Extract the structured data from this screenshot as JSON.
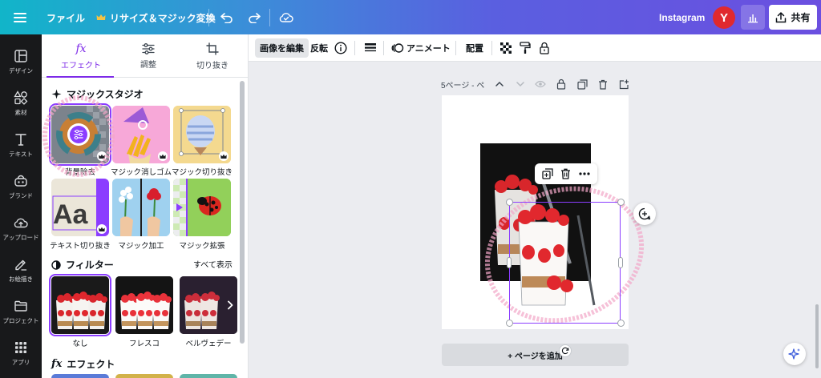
{
  "topbar": {
    "file_label": "ファイル",
    "resize_label": "リサイズ＆マジック変換",
    "design_type": "Instagram",
    "avatar_initial": "Y",
    "share_label": "共有"
  },
  "rail": {
    "items": [
      {
        "label": "デザイン",
        "icon": "layout-icon"
      },
      {
        "label": "素材",
        "icon": "shapes-icon"
      },
      {
        "label": "テキスト",
        "icon": "text-icon"
      },
      {
        "label": "ブランド",
        "icon": "brand-icon"
      },
      {
        "label": "アップロード",
        "icon": "upload-cloud-icon"
      },
      {
        "label": "お絵描き",
        "icon": "draw-icon"
      },
      {
        "label": "プロジェクト",
        "icon": "folder-icon"
      },
      {
        "label": "アプリ",
        "icon": "apps-grid-icon"
      }
    ]
  },
  "panel": {
    "tabs": [
      {
        "label": "エフェクト",
        "icon": "fx-icon",
        "active": true
      },
      {
        "label": "調整",
        "icon": "sliders-icon",
        "active": false
      },
      {
        "label": "切り抜き",
        "icon": "crop-icon",
        "active": false
      }
    ],
    "magic_studio": {
      "title": "マジックスタジオ",
      "tools": [
        {
          "label": "背景除去"
        },
        {
          "label": "マジック消しゴム"
        },
        {
          "label": "マジック切り抜き"
        },
        {
          "label": "テキスト切り抜き"
        },
        {
          "label": "マジック加工"
        },
        {
          "label": "マジック拡張"
        }
      ]
    },
    "filters": {
      "title": "フィルター",
      "see_all": "すべて表示",
      "items": [
        {
          "label": "なし",
          "selected": true
        },
        {
          "label": "フレスコ",
          "selected": false
        },
        {
          "label": "ベルヴェデー",
          "selected": false
        }
      ]
    },
    "effects": {
      "title": "エフェクト"
    }
  },
  "context_toolbar": {
    "edit_image": "画像を編集",
    "flip": "反転",
    "animate": "アニメート",
    "position": "配置"
  },
  "canvas": {
    "page_label": "5ページ - ペ",
    "add_page": "+ ページを追加"
  },
  "colors": {
    "accent": "#8b3dff",
    "rail_bg": "#18191b",
    "avatar_bg": "#e0292e",
    "canvas_bg": "#ebecf0"
  }
}
